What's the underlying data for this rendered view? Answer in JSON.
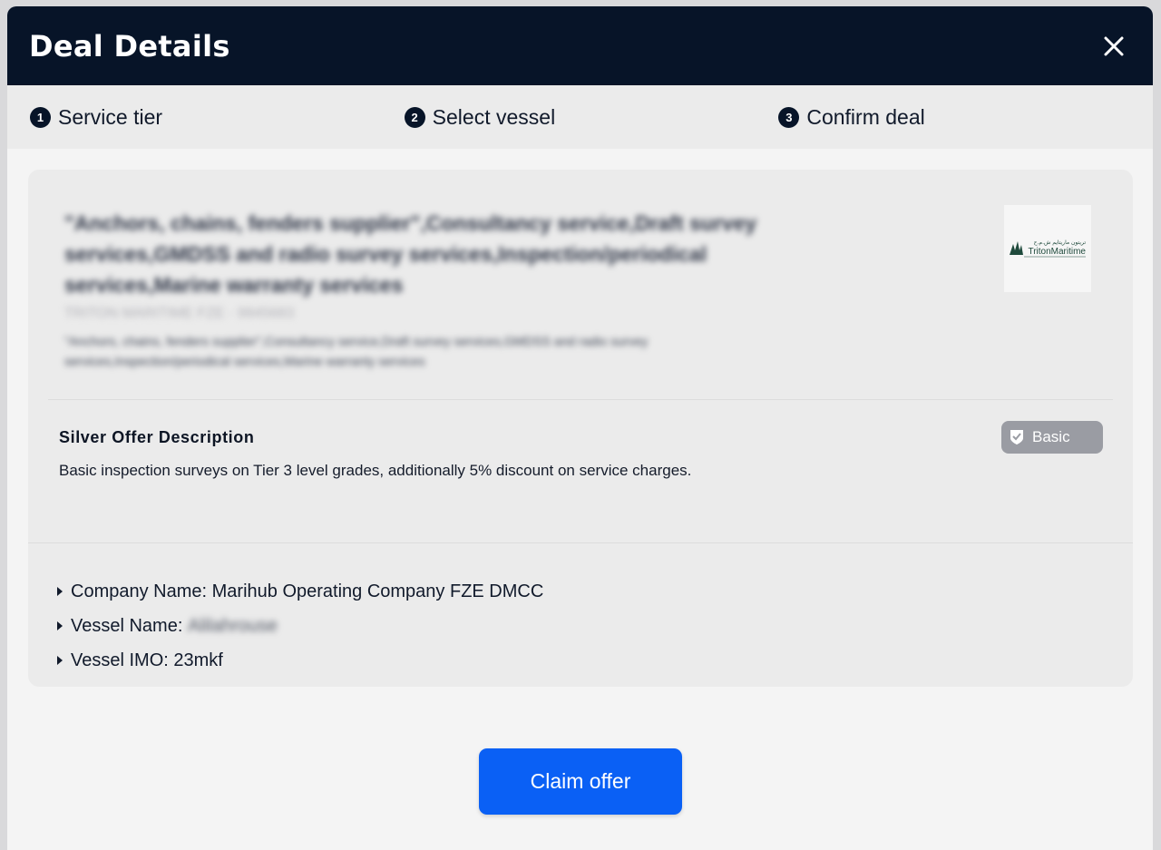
{
  "header": {
    "title": "Deal Details",
    "close_icon": "close-icon"
  },
  "steps": [
    {
      "number": "1",
      "label": "Service tier"
    },
    {
      "number": "2",
      "label": "Select vessel"
    },
    {
      "number": "3",
      "label": "Confirm deal"
    }
  ],
  "listing": {
    "services_title": "\"Anchors, chains, fenders supplier\",Consultancy service,Draft survey services,GMDSS and radio survey services,Inspection/periodical services,Marine warranty services",
    "company_line": "TRITON MARITIME FZE · 9845683",
    "services_desc": "\"Anchors, chains, fenders supplier\",Consultancy service,Draft survey services,GMDSS and radio survey services,Inspection/periodical services,Marine warranty services",
    "logo": {
      "arabic": "تريتون ماريتايم ش.م.ح",
      "text": "TritonMaritime"
    }
  },
  "offer": {
    "title": "Silver Offer Description",
    "description": "Basic inspection surveys on Tier 3 level grades, additionally 5% discount on service charges.",
    "badge_label": "Basic",
    "badge_icon": "shield-check-icon",
    "badge_color": "#9a9ca3"
  },
  "details": {
    "company_label": "Company Name: ",
    "company_value": "Marihub Operating Company FZE DMCC",
    "vessel_label": "Vessel Name: ",
    "vessel_value": "Alilahrouse",
    "imo_label": "Vessel IMO: ",
    "imo_value": "23mkf"
  },
  "actions": {
    "claim_label": "Claim offer",
    "claim_color": "#0a60f5"
  }
}
